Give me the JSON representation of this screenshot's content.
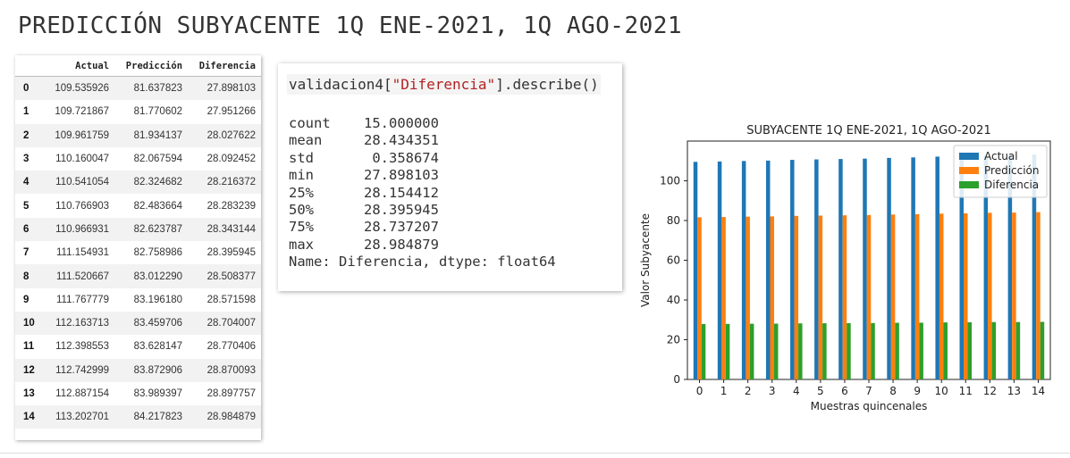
{
  "page_title": "PREDICCIÓN SUBYACENTE 1Q ENE-2021, 1Q AGO-2021",
  "table": {
    "columns": [
      "",
      "Actual",
      "Predicción",
      "Diferencia"
    ],
    "rows": [
      [
        "0",
        "109.535926",
        "81.637823",
        "27.898103"
      ],
      [
        "1",
        "109.721867",
        "81.770602",
        "27.951266"
      ],
      [
        "2",
        "109.961759",
        "81.934137",
        "28.027622"
      ],
      [
        "3",
        "110.160047",
        "82.067594",
        "28.092452"
      ],
      [
        "4",
        "110.541054",
        "82.324682",
        "28.216372"
      ],
      [
        "5",
        "110.766903",
        "82.483664",
        "28.283239"
      ],
      [
        "6",
        "110.966931",
        "82.623787",
        "28.343144"
      ],
      [
        "7",
        "111.154931",
        "82.758986",
        "28.395945"
      ],
      [
        "8",
        "111.520667",
        "83.012290",
        "28.508377"
      ],
      [
        "9",
        "111.767779",
        "83.196180",
        "28.571598"
      ],
      [
        "10",
        "112.163713",
        "83.459706",
        "28.704007"
      ],
      [
        "11",
        "112.398553",
        "83.628147",
        "28.770406"
      ],
      [
        "12",
        "112.742999",
        "83.872906",
        "28.870093"
      ],
      [
        "13",
        "112.887154",
        "83.989397",
        "28.897757"
      ],
      [
        "14",
        "113.202701",
        "84.217823",
        "28.984879"
      ]
    ]
  },
  "code": {
    "prefix": "validacion4[",
    "string": "\"Diferencia\"",
    "suffix": "].describe()",
    "output": [
      "count    15.000000",
      "mean     28.434351",
      "std       0.358674",
      "min      27.898103",
      "25%      28.154412",
      "50%      28.395945",
      "75%      28.737207",
      "max      28.984879",
      "Name: Diferencia, dtype: float64"
    ]
  },
  "chart_data": {
    "type": "bar",
    "title": "SUBYACENTE 1Q ENE-2021, 1Q AGO-2021",
    "xlabel": "Muestras quincenales",
    "ylabel": "Valor Subyacente",
    "categories": [
      "0",
      "1",
      "2",
      "3",
      "4",
      "5",
      "6",
      "7",
      "8",
      "9",
      "10",
      "11",
      "12",
      "13",
      "14"
    ],
    "ylim": [
      0,
      120
    ],
    "yticks": [
      0,
      20,
      40,
      60,
      80,
      100
    ],
    "legend_position": "top-right",
    "grid": false,
    "series": [
      {
        "name": "Actual",
        "color": "#1f77b4",
        "values": [
          109.535926,
          109.721867,
          109.961759,
          110.160047,
          110.541054,
          110.766903,
          110.966931,
          111.154931,
          111.520667,
          111.767779,
          112.163713,
          112.398553,
          112.742999,
          112.887154,
          113.202701
        ]
      },
      {
        "name": "Predicción",
        "color": "#ff7f0e",
        "values": [
          81.637823,
          81.770602,
          81.934137,
          82.067594,
          82.324682,
          82.483664,
          82.623787,
          82.758986,
          83.01229,
          83.19618,
          83.459706,
          83.628147,
          83.872906,
          83.989397,
          84.217823
        ]
      },
      {
        "name": "Diferencia",
        "color": "#2ca02c",
        "values": [
          27.898103,
          27.951266,
          28.027622,
          28.092452,
          28.216372,
          28.283239,
          28.343144,
          28.395945,
          28.508377,
          28.571598,
          28.704007,
          28.770406,
          28.870093,
          28.897757,
          28.984879
        ]
      }
    ]
  }
}
